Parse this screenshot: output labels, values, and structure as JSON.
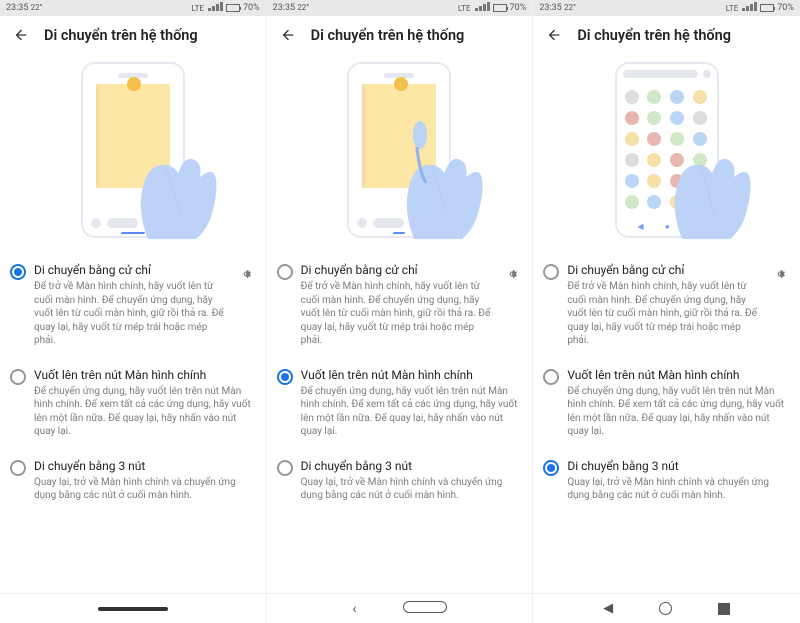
{
  "status": {
    "time": "23:35",
    "temp": "22°",
    "net": "LTE",
    "battery": "70%"
  },
  "header": {
    "title": "Di chuyển trên hệ thống"
  },
  "options": {
    "gesture": {
      "title": "Di chuyển bằng cử chỉ",
      "desc": "Để trở về Màn hình chính, hãy vuốt lên từ cuối màn hình. Để chuyển ứng dụng, hãy vuốt lên từ cuối màn hình, giữ rồi thả ra. Để quay lại, hãy vuốt từ mép trái hoặc mép phải."
    },
    "swipe": {
      "title": "Vuốt lên trên nút Màn hình chính",
      "desc": "Để chuyển ứng dụng, hãy vuốt lên trên nút Màn hình chính. Để xem tất cả các ứng dụng, hãy vuốt lên một lần nữa. Để quay lại, hãy nhấn vào nút quay lại."
    },
    "three": {
      "title": "Di chuyển bằng 3 nút",
      "desc": "Quay lại, trở về Màn hình chính và chuyển ứng dụng bằng các nút ở cuối màn hình."
    }
  },
  "panes": [
    {
      "selected": "gesture",
      "illus": "gesture",
      "bottomNav": "pill"
    },
    {
      "selected": "swipe",
      "illus": "swipe",
      "bottomNav": "two"
    },
    {
      "selected": "three",
      "illus": "apps",
      "bottomNav": "three"
    }
  ]
}
